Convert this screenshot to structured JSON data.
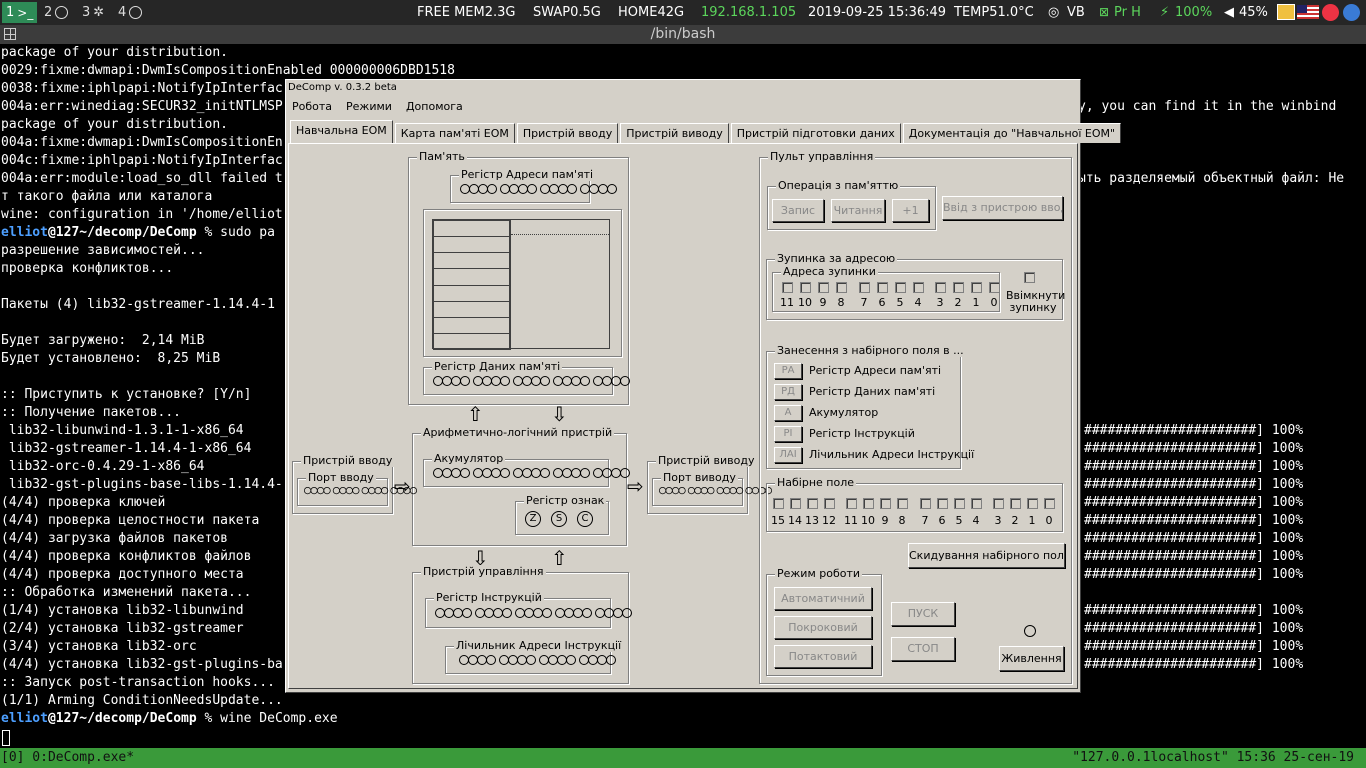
{
  "topbar": {
    "workspaces": [
      {
        "num": "1",
        "icon": "terminal-icon",
        "glyph": ">_"
      },
      {
        "num": "2",
        "icon": "firefox-icon",
        "glyph": ""
      },
      {
        "num": "3",
        "icon": "settings-icon",
        "glyph": "✲"
      },
      {
        "num": "4",
        "icon": "chat-icon",
        "glyph": ""
      }
    ],
    "freemem": "FREE MEM2.3G",
    "swap": "SWAP0.5G",
    "home": "HOME42G",
    "ip": "192.168.1.105",
    "datetime": "2019-09-25 15:36:49",
    "temp": "TEMP51.0°C",
    "vb": "VB",
    "pr": "Pr H",
    "battery": "100%",
    "volume": "45%"
  },
  "titlebar": {
    "title": "/bin/bash"
  },
  "terminal": {
    "lines": [
      "package of your distribution.",
      "0029:fixme:dwmapi:DwmIsCompositionEnabled 000000006DBD1518",
      "0038:fixme:iphlpapi:NotifyIpInterfac",
      "004a:err:winediag:SECUR32_initNTLMSP",
      "package of your distribution.",
      "004a:fixme:dwmapi:DwmIsCompositionEn",
      "004c:fixme:iphlpapi:NotifyIpInterfac",
      "004a:err:module:load_so_dll failed t",
      "т такого файла или каталога",
      "wine: configuration in '/home/elliot",
      "",
      "разрешение зависимостей...",
      "проверка конфликтов...",
      "",
      "Пакеты (4) lib32-gstreamer-1.14.4-1",
      "",
      "Будет загружено:  2,14 MiB",
      "Будет установлено:  8,25 MiB",
      "",
      ":: Приступить к установке? [Y/n]",
      ":: Получение пакетов...",
      " lib32-libunwind-1.3.1-1-x86_64",
      " lib32-gstreamer-1.14.4-1-x86_64",
      " lib32-orc-0.4.29-1-x86_64",
      " lib32-gst-plugins-base-libs-1.14.4-",
      "(4/4) проверка ключей",
      "(4/4) проверка целостности пакета",
      "(4/4) загрузка файлов пакетов",
      "(4/4) проверка конфликтов файлов",
      "(4/4) проверка доступного места",
      ":: Обработка изменений пакета...",
      "(1/4) установка lib32-libunwind",
      "(2/4) установка lib32-gstreamer",
      "(3/4) установка lib32-orc",
      "(4/4) установка lib32-gst-plugins-ba",
      ":: Запуск post-transaction hooks...",
      "(1/1) Arming ConditionNeedsUpdate..."
    ],
    "prompt_user": "elliot",
    "prompt_host": "@127",
    "prompt_path": "~/decomp/DeComp",
    "cmd1": " % sudo pa",
    "cmd2": " % wine DeComp.exe",
    "right": [
      {
        "row": 3,
        "text": "y, you can find it in the winbind"
      },
      {
        "row": 7,
        "text": "ыть разделяемый объектный файл: Не"
      },
      {
        "row": 21,
        "text": "######################] 100%"
      },
      {
        "row": 22,
        "text": "######################] 100%"
      },
      {
        "row": 23,
        "text": "######################] 100%"
      },
      {
        "row": 24,
        "text": "######################] 100%"
      },
      {
        "row": 25,
        "text": "######################] 100%"
      },
      {
        "row": 26,
        "text": "######################] 100%"
      },
      {
        "row": 27,
        "text": "######################] 100%"
      },
      {
        "row": 28,
        "text": "######################] 100%"
      },
      {
        "row": 29,
        "text": "######################] 100%"
      },
      {
        "row": 31,
        "text": "######################] 100%"
      },
      {
        "row": 32,
        "text": "######################] 100%"
      },
      {
        "row": 33,
        "text": "######################] 100%"
      },
      {
        "row": 34,
        "text": "######################] 100%"
      }
    ]
  },
  "statusbar": {
    "left": "[0] 0:DeComp.exe*",
    "right": "\"127.0.0.1localhost\" 15:36 25-сен-19"
  },
  "window": {
    "title": "DeComp v. 0.3.2 beta",
    "menu": [
      "Робота",
      "Режими",
      "Допомога"
    ],
    "tabs": [
      "Навчальна ЕОМ",
      "Карта пам'яті ЕОМ",
      "Пристрій вводу",
      "Пристрій виводу",
      "Пристрій підготовки даних",
      "Документація до \"Навчальної ЕОМ\""
    ],
    "memory": {
      "title": "Пам'ять",
      "addr_reg": "Регістр Адреси  пам'яті",
      "data_reg": "Регістр Даних пам'яті"
    },
    "alu": {
      "title": "Арифметично-логічний пристрій",
      "acc": "Акумулятор",
      "flags_title": "Регістр ознак",
      "flags": [
        "Z",
        "S",
        "C"
      ]
    },
    "input": {
      "title": "Пристрій вводу",
      "port": "Порт вводу"
    },
    "output": {
      "title": "Пристрій виводу",
      "port": "Порт виводу"
    },
    "control": {
      "title": "Пристрій управління",
      "ir": "Регістр Інструкцій",
      "pc": "Лічильник Адреси Інструкції"
    },
    "panel": {
      "title": "Пульт управління",
      "memop": {
        "title": "Операція з пам'яттю",
        "write": "Запис",
        "read": "Читання",
        "inc": "+1"
      },
      "input_btn": "Ввід з пристрою вводу",
      "stop": {
        "title": "Зупинка за адресою",
        "addr": "Адреса зупинки",
        "nums": [
          "11",
          "10",
          "9",
          "8",
          "7",
          "6",
          "5",
          "4",
          "3",
          "2",
          "1",
          "0"
        ],
        "enable": "Ввімкнути зупинку"
      },
      "load": {
        "title": "Занесення з набірного поля в ...",
        "items": [
          {
            "btn": "РА",
            "label": "Регістр Адреси  пам'яті"
          },
          {
            "btn": "РД",
            "label": "Регістр Даних пам'яті"
          },
          {
            "btn": "А",
            "label": "Акумулятор"
          },
          {
            "btn": "РІ",
            "label": "Регістр Інструкцій"
          },
          {
            "btn": "ЛАІ",
            "label": "Лічильник Адреси Інструкції"
          }
        ]
      },
      "field": {
        "title": "Набірне поле",
        "nums": [
          "15",
          "14",
          "13",
          "12",
          "11",
          "10",
          "9",
          "8",
          "7",
          "6",
          "5",
          "4",
          "3",
          "2",
          "1",
          "0"
        ]
      },
      "reset": "Скидування набірного поля",
      "mode": {
        "title": "Режим роботи",
        "auto": "Автоматичний",
        "step": "Покроковий",
        "tact": "Потактовий"
      },
      "start": "ПУСК",
      "stopbtn": "СТОП",
      "power": "Живлення"
    }
  }
}
